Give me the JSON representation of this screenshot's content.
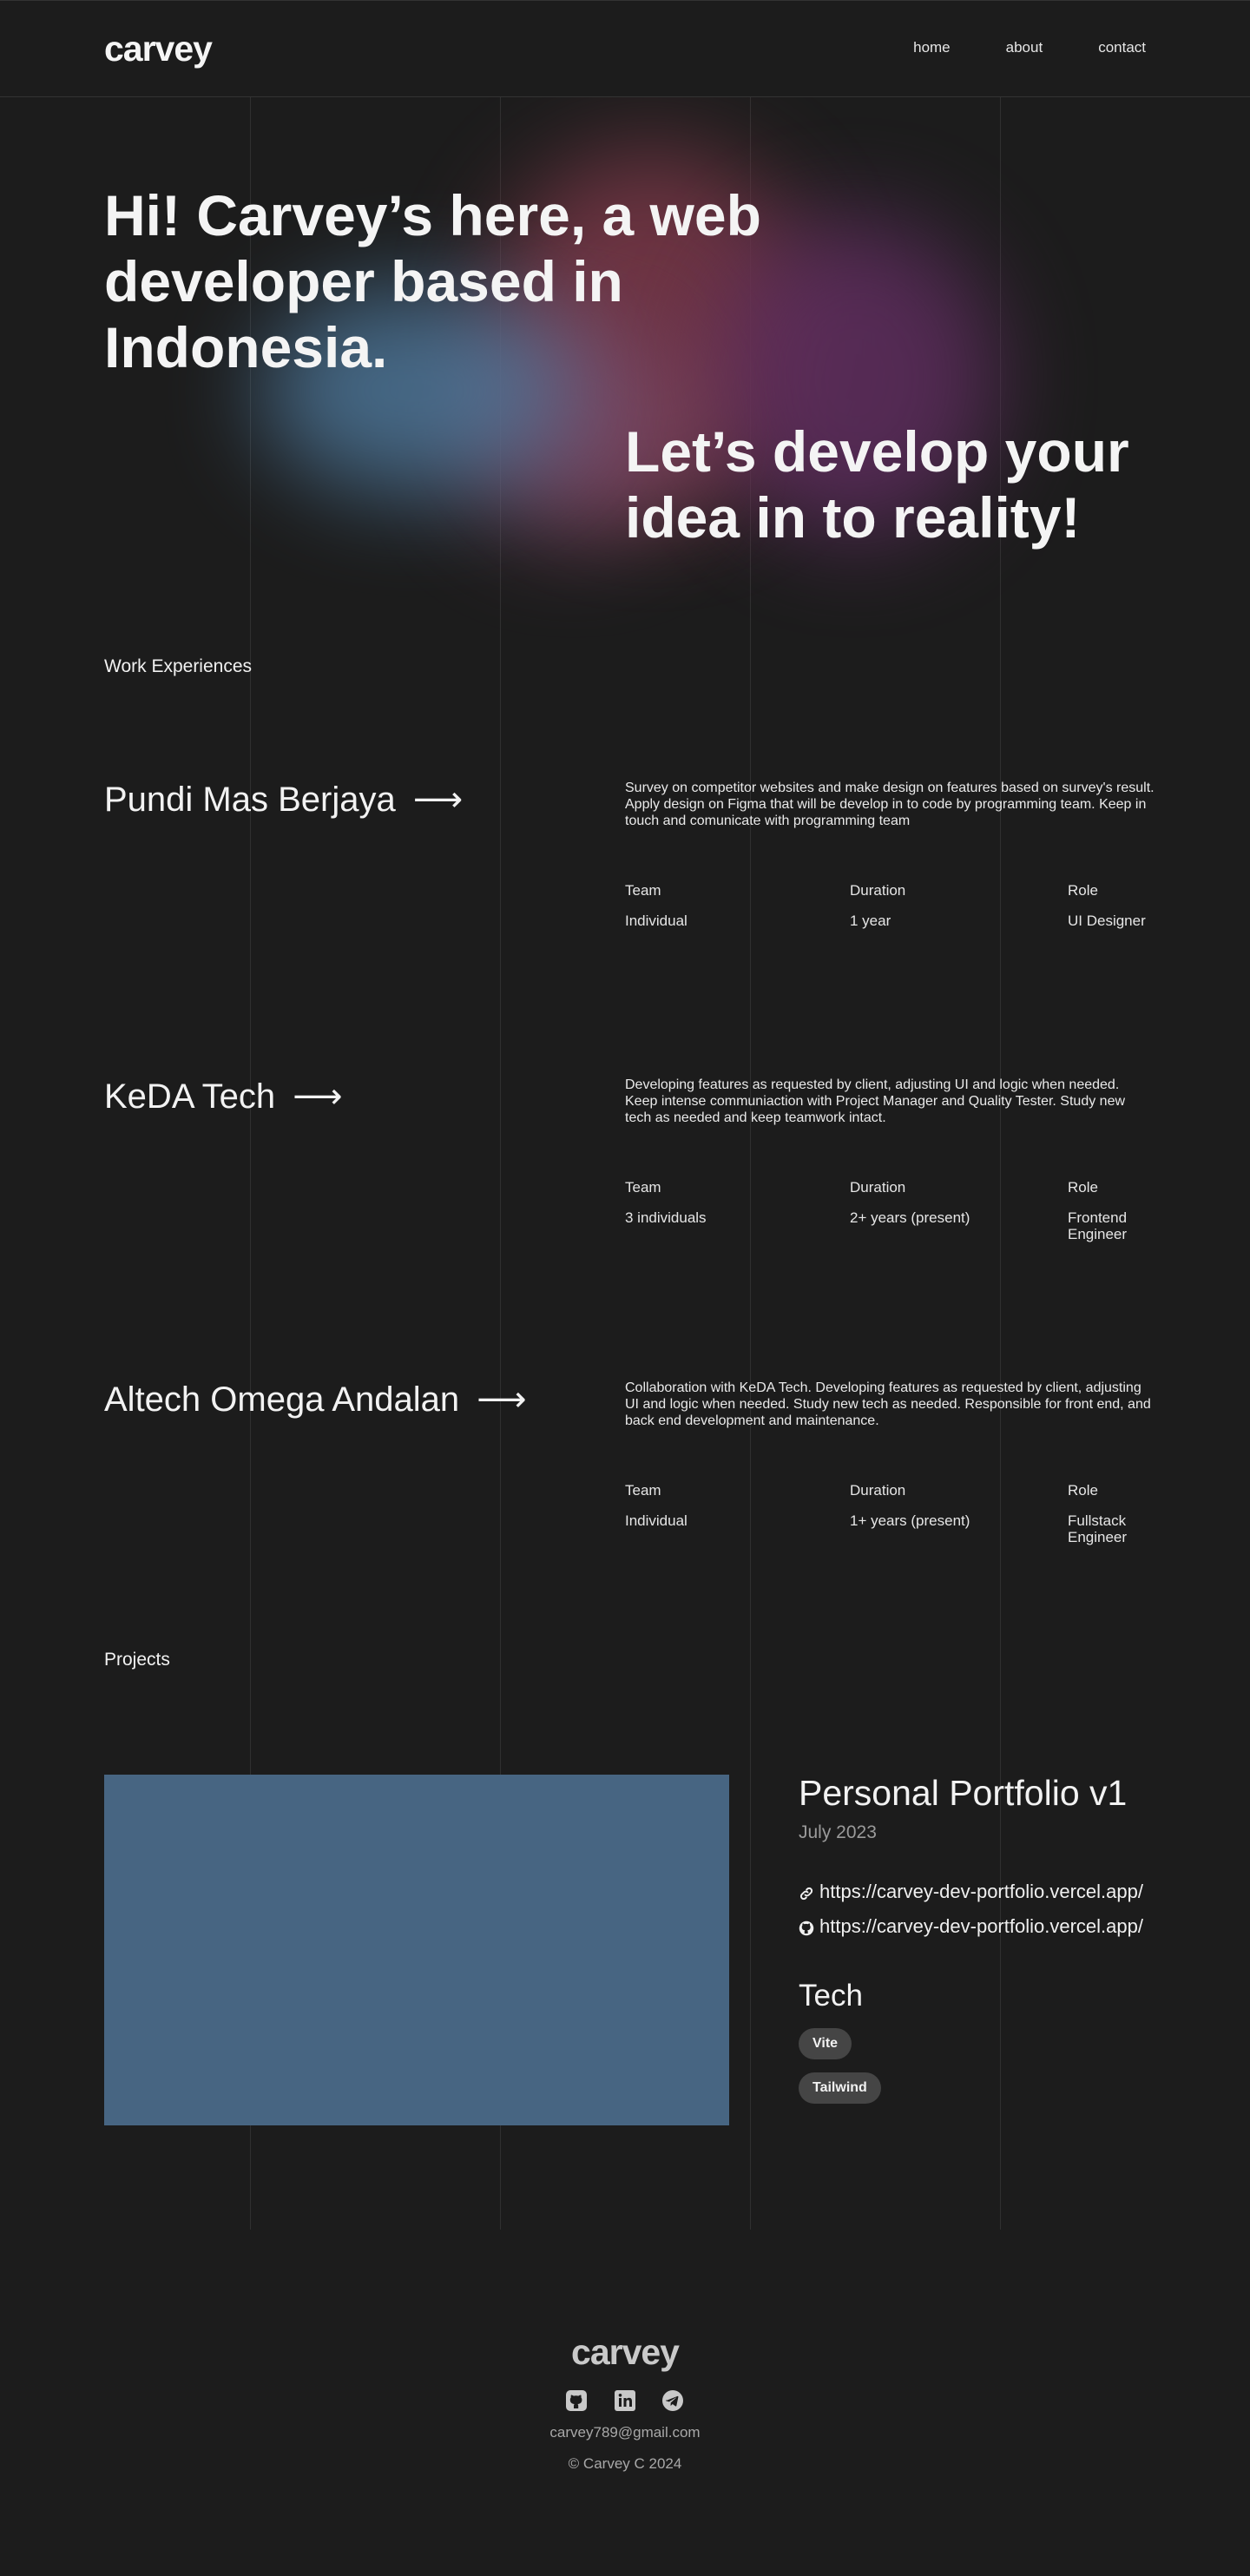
{
  "brand": "carvey",
  "nav": [
    "home",
    "about",
    "contact"
  ],
  "hero": {
    "line1": "Hi! Carvey’s here, a web developer based in Indonesia.",
    "line2": "Let’s develop your idea in to reality!"
  },
  "experience_section": "Work Experiences",
  "experiences": [
    {
      "company": "Pundi Mas Berjaya",
      "description": "Survey on competitor websites and make design on features based on survey's result. Apply design on Figma that will be develop in to code by programming team. Keep in touch and comunicate with programming team",
      "team_label": "Team",
      "team": "Individual",
      "duration_label": "Duration",
      "duration": "1 year",
      "role_label": "Role",
      "role": "UI Designer"
    },
    {
      "company": "KeDA Tech",
      "description": "Developing features as requested by client, adjusting UI and logic when needed. Keep intense communiaction with Project Manager and Quality Tester. Study new tech as needed and keep teamwork intact.",
      "team_label": "Team",
      "team": "3 individuals",
      "duration_label": "Duration",
      "duration": "2+ years (present)",
      "role_label": "Role",
      "role": "Frontend Engineer"
    },
    {
      "company": "Altech Omega Andalan",
      "description": "Collaboration with KeDA Tech. Developing features as requested by client, adjusting UI and logic when needed. Study new tech as needed. Responsible for front end, and back end development and maintenance.",
      "team_label": "Team",
      "team": "Individual",
      "duration_label": "Duration",
      "duration": "1+ years (present)",
      "role_label": "Role",
      "role": "Fullstack Engineer"
    }
  ],
  "projects_section": "Projects",
  "project": {
    "title": "Personal Portfolio v1",
    "date": "July 2023",
    "link": "https://carvey-dev-portfolio.vercel.app/",
    "repo": "https://carvey-dev-portfolio.vercel.app/",
    "tech_title": "Tech",
    "tech": [
      "Vite",
      "Tailwind"
    ]
  },
  "footer": {
    "brand": "carvey",
    "email": "carvey789@gmail.com",
    "copyright": "©  Carvey C 2024",
    "socials": [
      "github-icon",
      "linkedin-icon",
      "telegram-icon"
    ]
  }
}
